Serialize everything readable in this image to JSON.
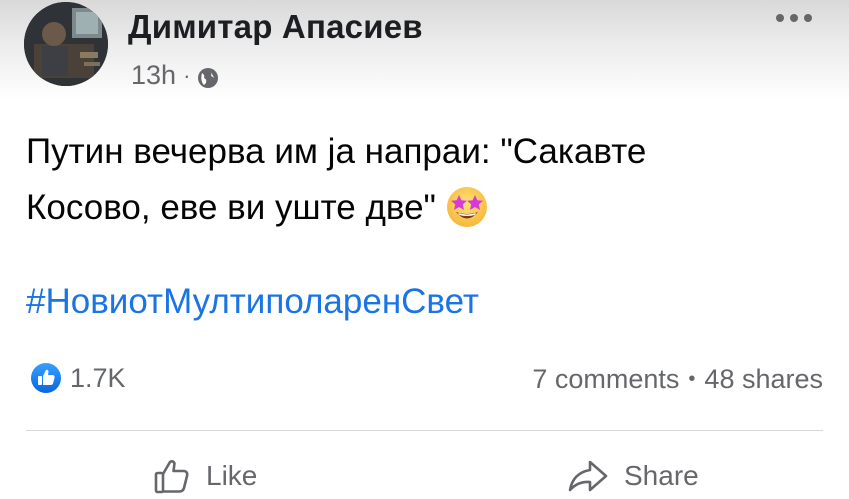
{
  "post": {
    "author": "Димитар Апасиев",
    "time": "13h",
    "meta_separator": "·",
    "privacy_icon": "globe-icon",
    "text_line1": "Путин вечерва им ја напраи: \"Сакавте",
    "text_line2": "Косово, еве ви уште две\"",
    "emoji": "star-struck-emoji",
    "hashtag": "#НовиотМултиполаренСвет"
  },
  "engagement": {
    "reaction_icon": "like-reaction-icon",
    "reaction_count": "1.7K",
    "comments": "7 comments",
    "separator": "•",
    "shares": "48 shares"
  },
  "actions": {
    "like_label": "Like",
    "share_label": "Share"
  },
  "colors": {
    "link": "#1b74e4",
    "secondary_text": "#65676b",
    "primary_text": "#050505"
  }
}
